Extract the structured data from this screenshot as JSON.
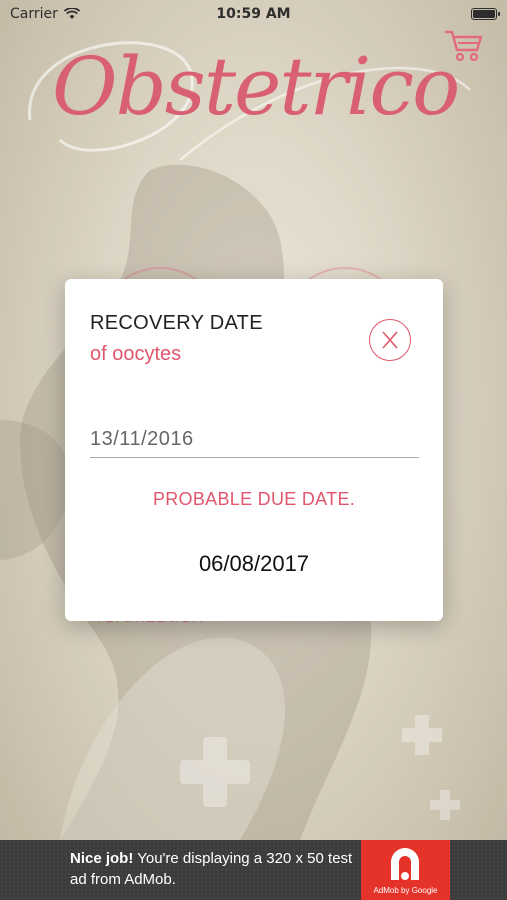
{
  "status_bar": {
    "carrier": "Carrier",
    "time": "10:59 AM",
    "wifi_icon": "wifi-icon",
    "battery_icon": "battery-icon"
  },
  "app": {
    "logo_text": "Obstetrico",
    "cart_icon": "shopping-cart-icon",
    "background_label": "fertilization"
  },
  "dialog": {
    "title": "RECOVERY DATE",
    "subtitle": "of oocytes",
    "close_icon": "close-icon",
    "date_value": "13/11/2016",
    "result_label": "PROBABLE DUE DATE.",
    "result_value": "06/08/2017"
  },
  "ad": {
    "bold_text": "Nice job!",
    "text": " You're displaying a 320 x 50 test ad from AdMob.",
    "logo_caption": "AdMob by Google"
  },
  "colors": {
    "accent": "#e0566c",
    "ad_red": "#e6332a",
    "ad_bg": "#3c3c3c"
  }
}
